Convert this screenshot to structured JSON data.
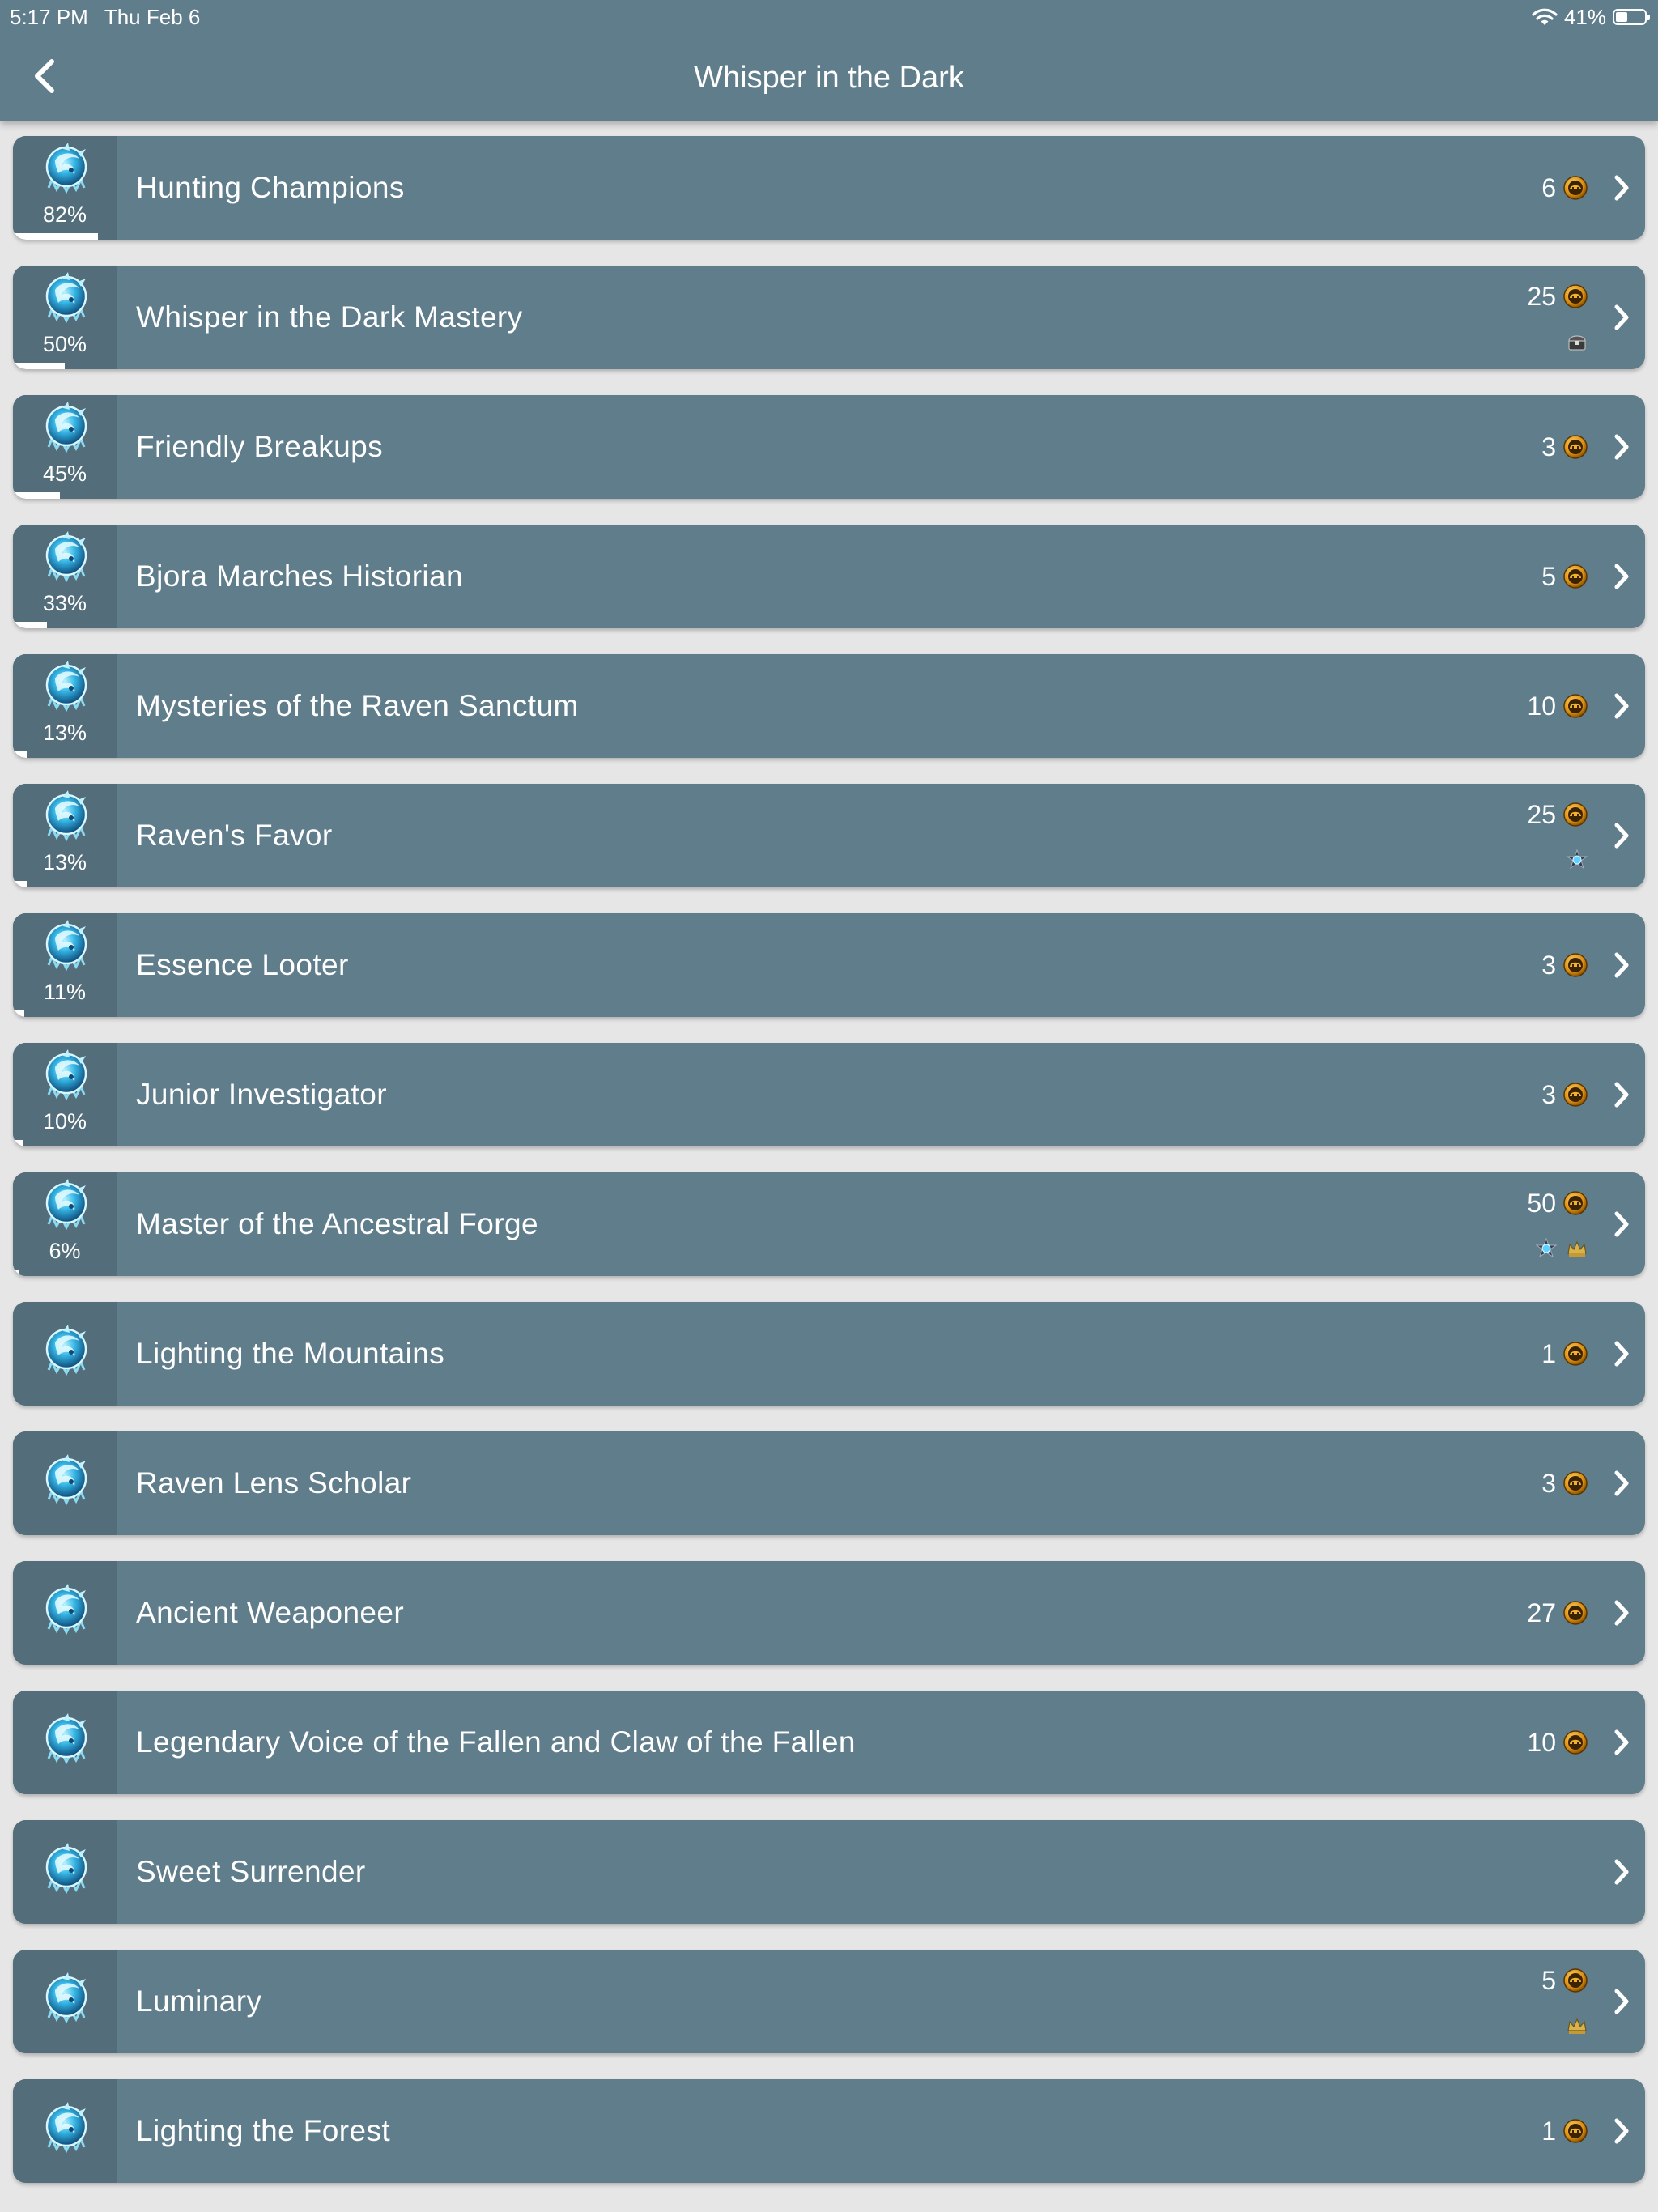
{
  "status_bar": {
    "time": "5:17 PM",
    "date": "Thu Feb 6",
    "battery": "41%",
    "battery_level": 0.41
  },
  "header": {
    "title": "Whisper in the Dark"
  },
  "colors": {
    "bar": "#607d8b",
    "icon_cell": "#536d7a",
    "background": "#e6e6e6",
    "coin": "#e0a020"
  },
  "achievements": [
    {
      "title": "Hunting Champions",
      "percent": "82%",
      "progress": 0.82,
      "points": "6",
      "extras": []
    },
    {
      "title": "Whisper in the Dark Mastery",
      "percent": "50%",
      "progress": 0.5,
      "points": "25",
      "extras": [
        "chest-icon"
      ]
    },
    {
      "title": "Friendly Breakups",
      "percent": "45%",
      "progress": 0.45,
      "points": "3",
      "extras": []
    },
    {
      "title": "Bjora Marches Historian",
      "percent": "33%",
      "progress": 0.33,
      "points": "5",
      "extras": []
    },
    {
      "title": "Mysteries of the Raven Sanctum",
      "percent": "13%",
      "progress": 0.13,
      "points": "10",
      "extras": []
    },
    {
      "title": "Raven's Favor",
      "percent": "13%",
      "progress": 0.13,
      "points": "25",
      "extras": [
        "mastery-icon"
      ]
    },
    {
      "title": "Essence Looter",
      "percent": "11%",
      "progress": 0.11,
      "points": "3",
      "extras": []
    },
    {
      "title": "Junior Investigator",
      "percent": "10%",
      "progress": 0.1,
      "points": "3",
      "extras": []
    },
    {
      "title": "Master of the Ancestral Forge",
      "percent": "6%",
      "progress": 0.06,
      "points": "50",
      "extras": [
        "mastery-icon",
        "crown-icon"
      ]
    },
    {
      "title": "Lighting the Mountains",
      "percent": "",
      "progress": 0,
      "points": "1",
      "extras": []
    },
    {
      "title": "Raven Lens Scholar",
      "percent": "",
      "progress": 0,
      "points": "3",
      "extras": []
    },
    {
      "title": "Ancient Weaponeer",
      "percent": "",
      "progress": 0,
      "points": "27",
      "extras": []
    },
    {
      "title": "Legendary Voice of the Fallen and Claw of the Fallen",
      "percent": "",
      "progress": 0,
      "points": "10",
      "extras": []
    },
    {
      "title": "Sweet Surrender",
      "percent": "",
      "progress": 0,
      "points": "",
      "extras": []
    },
    {
      "title": "Luminary",
      "percent": "",
      "progress": 0,
      "points": "5",
      "extras": [
        "crown-icon"
      ]
    },
    {
      "title": "Lighting the Forest",
      "percent": "",
      "progress": 0,
      "points": "1",
      "extras": []
    }
  ]
}
